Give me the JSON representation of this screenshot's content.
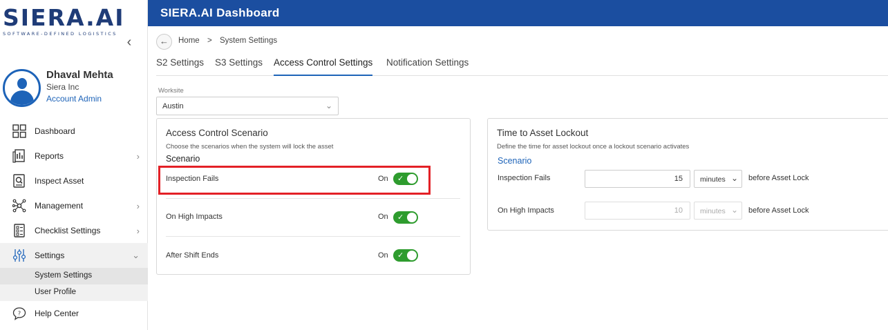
{
  "brand": {
    "logo_main": "SIERA.AI",
    "logo_sub": "SOFTWARE-DEFINED LOGISTICS"
  },
  "header": {
    "title": "SIERA.AI Dashboard"
  },
  "profile": {
    "name": "Dhaval Mehta",
    "org": "Siera Inc",
    "role": "Account Admin"
  },
  "sidebar": {
    "items": [
      {
        "label": "Dashboard",
        "icon": "dashboard-icon"
      },
      {
        "label": "Reports",
        "icon": "reports-icon"
      },
      {
        "label": "Inspect Asset",
        "icon": "inspect-asset-icon"
      },
      {
        "label": "Management",
        "icon": "management-icon"
      },
      {
        "label": "Checklist Settings",
        "icon": "checklist-icon"
      },
      {
        "label": "Settings",
        "icon": "settings-sliders-icon"
      },
      {
        "label": "Help Center",
        "icon": "help-icon"
      }
    ],
    "sub_items": [
      "System Settings",
      "User Profile"
    ]
  },
  "breadcrumb": {
    "home": "Home",
    "separator": ">",
    "current": "System Settings"
  },
  "tabs": [
    "S2 Settings",
    "S3 Settings",
    "Access Control Settings",
    "Notification Settings"
  ],
  "worksite": {
    "label": "Worksite",
    "value": "Austin"
  },
  "access_control": {
    "title": "Access Control Scenario",
    "description": "Choose the scenarios when the system will lock the asset",
    "scenario_heading": "Scenario",
    "rows": [
      {
        "label": "Inspection Fails",
        "state": "On"
      },
      {
        "label": "On High Impacts",
        "state": "On"
      },
      {
        "label": "After Shift Ends",
        "state": "On"
      }
    ]
  },
  "lockout": {
    "title": "Time to Asset Lockout",
    "description": "Define the time for asset lockout once a lockout scenario activates",
    "scenario_heading": "Scenario",
    "after_label": "before Asset Lock",
    "rows": [
      {
        "label": "Inspection Fails",
        "value": "15",
        "unit": "minutes"
      },
      {
        "label": "On High Impacts",
        "value": "10",
        "unit": "minutes"
      }
    ]
  },
  "colors": {
    "header_bg": "#1b4ea0",
    "accent": "#1d63b8",
    "toggle_on": "#2e9c2e",
    "highlight": "#e32026"
  }
}
